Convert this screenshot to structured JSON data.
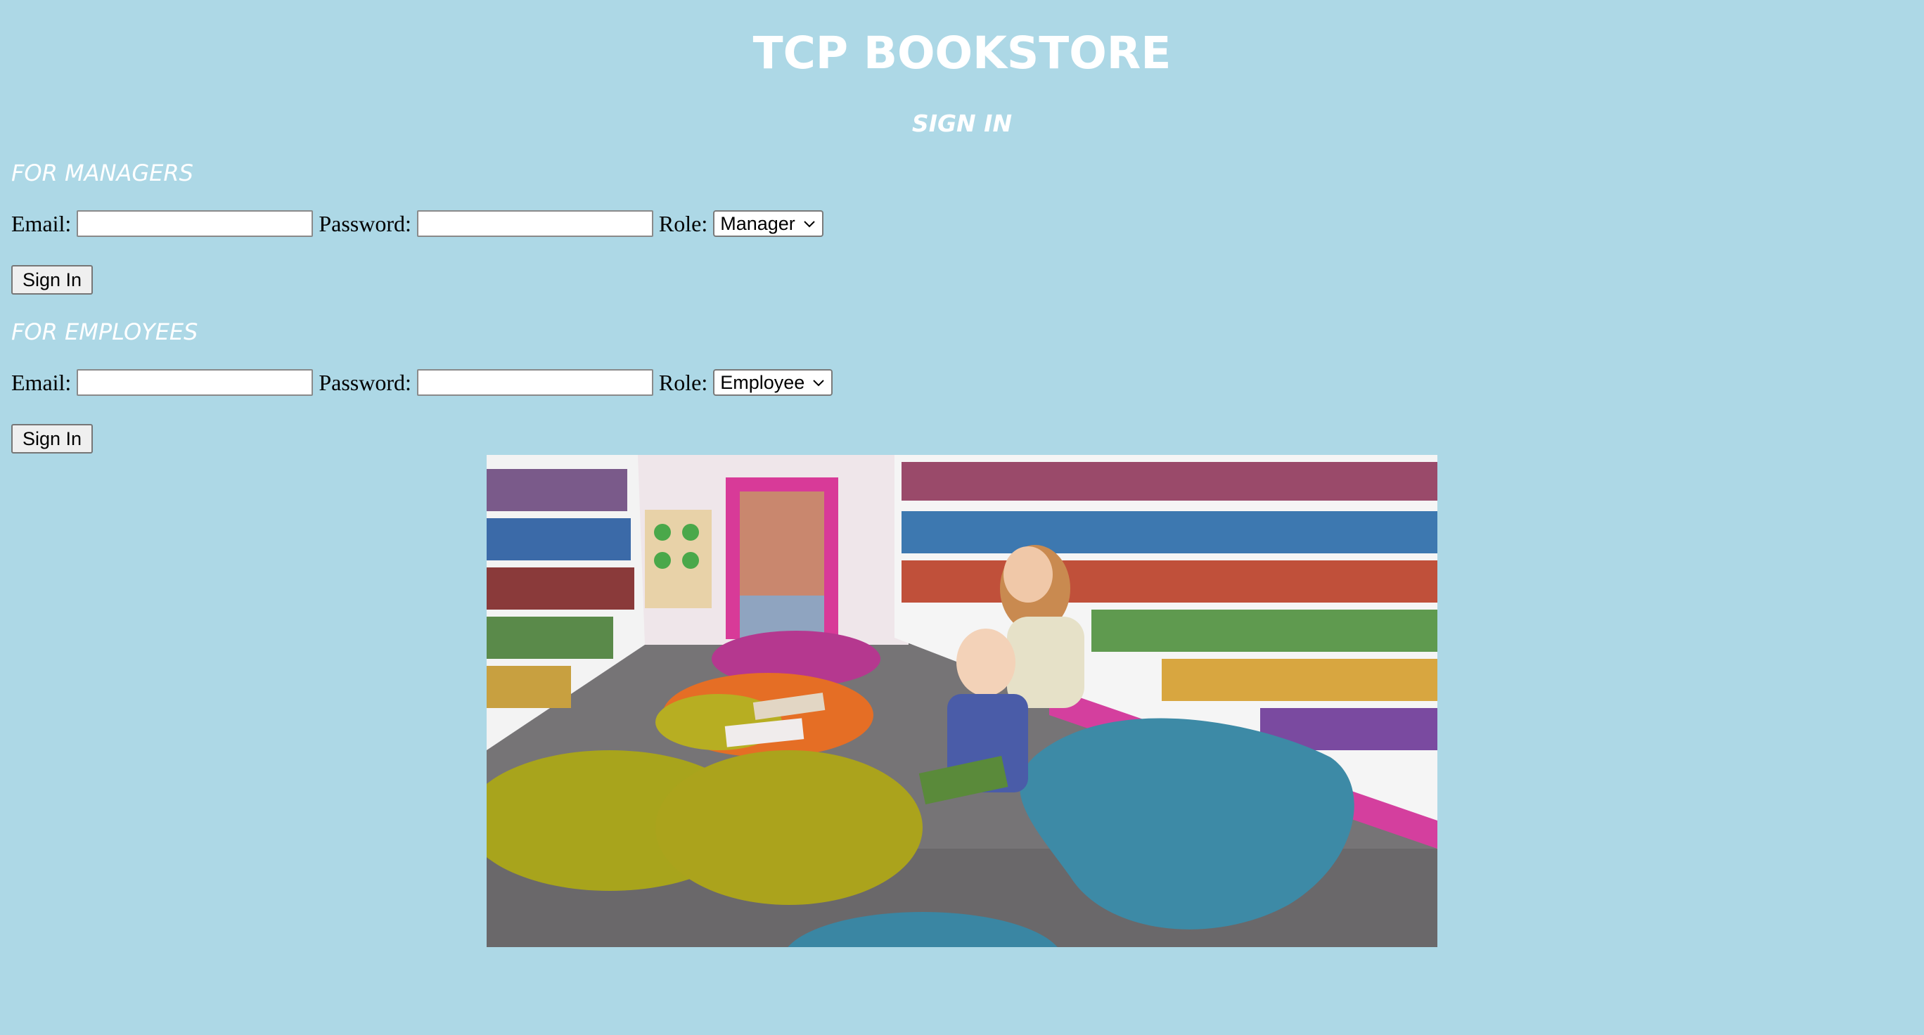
{
  "header": {
    "title": "TCP BOOKSTORE",
    "subtitle": "SIGN IN"
  },
  "managers": {
    "heading": "FOR MANAGERS",
    "email_label": "Email:",
    "email_value": "",
    "password_label": "Password:",
    "password_value": "",
    "role_label": "Role:",
    "role_selected": "Manager",
    "button_label": "Sign In"
  },
  "employees": {
    "heading": "FOR EMPLOYEES",
    "email_label": "Email:",
    "email_value": "",
    "password_label": "Password:",
    "password_value": "",
    "role_label": "Role:",
    "role_selected": "Employee",
    "button_label": "Sign In"
  },
  "colors": {
    "background": "#add8e6",
    "heading_text": "#ffffff"
  },
  "icons": {
    "dropdown": "chevron-down-icon"
  }
}
